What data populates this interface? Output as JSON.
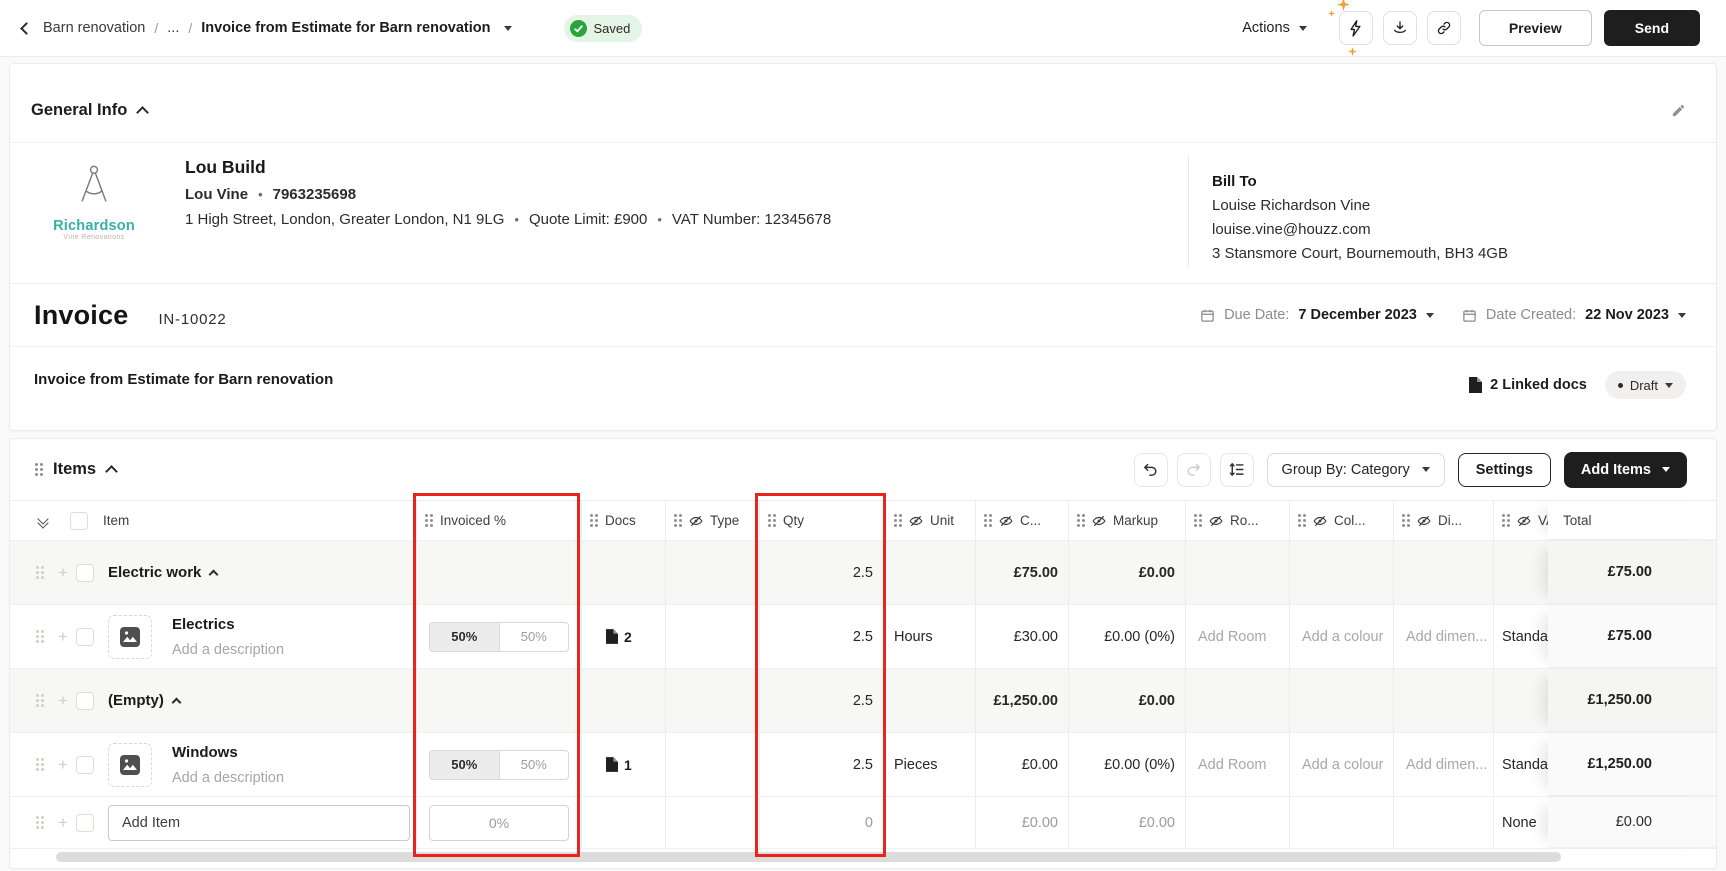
{
  "ui": {
    "bullet": "•"
  },
  "topbar": {
    "breadcrumb": {
      "project": "Barn renovation",
      "separator": "/",
      "ellipsis": "...",
      "current": "Invoice from Estimate for Barn renovation"
    },
    "saved": "Saved",
    "actions": "Actions",
    "preview": "Preview",
    "send": "Send"
  },
  "general_info": {
    "title": "General Info",
    "logo_name": "Richardson",
    "logo_subtitle": "Vine Renovations",
    "company_name": "Lou Build",
    "company_contact": "Lou Vine",
    "company_phone": "7963235698",
    "company_address": "1 High Street, London, Greater London, N1 9LG",
    "quote_limit": "Quote Limit: £900",
    "vat_number": "VAT Number: 12345678",
    "bill_to_label": "Bill To",
    "bill_to_name": "Louise Richardson Vine",
    "bill_to_email": "louise.vine@houzz.com",
    "bill_to_address": "3 Stansmore Court, Bournemouth, BH3 4GB"
  },
  "invoice": {
    "title": "Invoice",
    "number": "IN-10022",
    "due_date_label": "Due Date:",
    "due_date": "7 December 2023",
    "date_created_label": "Date Created:",
    "date_created": "22 Nov 2023",
    "subtitle": "Invoice from Estimate for Barn renovation",
    "linked_docs": "2 Linked docs",
    "status": "Draft"
  },
  "items": {
    "title": "Items",
    "group_by": "Group By: Category",
    "settings": "Settings",
    "add_items": "Add Items",
    "header": {
      "item": "Item",
      "invoiced": "Invoiced %",
      "docs": "Docs",
      "type": "Type",
      "qty": "Qty",
      "unit": "Unit",
      "cost": "C...",
      "markup": "Markup",
      "room": "Ro...",
      "colour": "Col...",
      "dimensions": "Di...",
      "vat": "VAT",
      "total": "Total"
    },
    "rows": [
      {
        "kind": "category",
        "name": "Electric work",
        "qty": "2.5",
        "cost": "£75.00",
        "markup": "£0.00",
        "total": "£75.00"
      },
      {
        "kind": "item",
        "name": "Electrics",
        "description": "Add a description",
        "invoiced_done": "50%",
        "invoiced_remaining": "50%",
        "docs": "2",
        "qty": "2.5",
        "unit": "Hours",
        "cost": "£30.00",
        "markup": "£0.00 (0%)",
        "room": "Add Room",
        "colour": "Add a colour",
        "dimensions": "Add dimen...",
        "vat": "Standard",
        "total": "£75.00"
      },
      {
        "kind": "category",
        "name": "(Empty)",
        "qty": "2.5",
        "cost": "£1,250.00",
        "markup": "£0.00",
        "total": "£1,250.00"
      },
      {
        "kind": "item",
        "name": "Windows",
        "description": "Add a description",
        "invoiced_done": "50%",
        "invoiced_remaining": "50%",
        "docs": "1",
        "qty": "2.5",
        "unit": "Pieces",
        "cost": "£0.00",
        "markup": "£0.00 (0%)",
        "room": "Add Room",
        "colour": "Add a colour",
        "dimensions": "Add dimen...",
        "vat": "Standard",
        "total": "£1,250.00"
      },
      {
        "kind": "add",
        "item_placeholder": "Add Item",
        "invoiced": "0%",
        "qty": "0",
        "cost": "£0.00",
        "markup": "£0.00",
        "vat": "None",
        "total": "£0.00"
      }
    ]
  },
  "annotations": {
    "color": "#e8251c",
    "highlighted_columns": [
      "Invoiced %",
      "Qty"
    ]
  },
  "colors": {
    "accent_teal": "#35b2a7",
    "saved_green": "#2aa53b",
    "saved_bg": "#e4f5e5",
    "dark_button": "#1e1e1e",
    "category_row_bg": "#f7f7f6",
    "annotation_red": "#e8251c"
  }
}
